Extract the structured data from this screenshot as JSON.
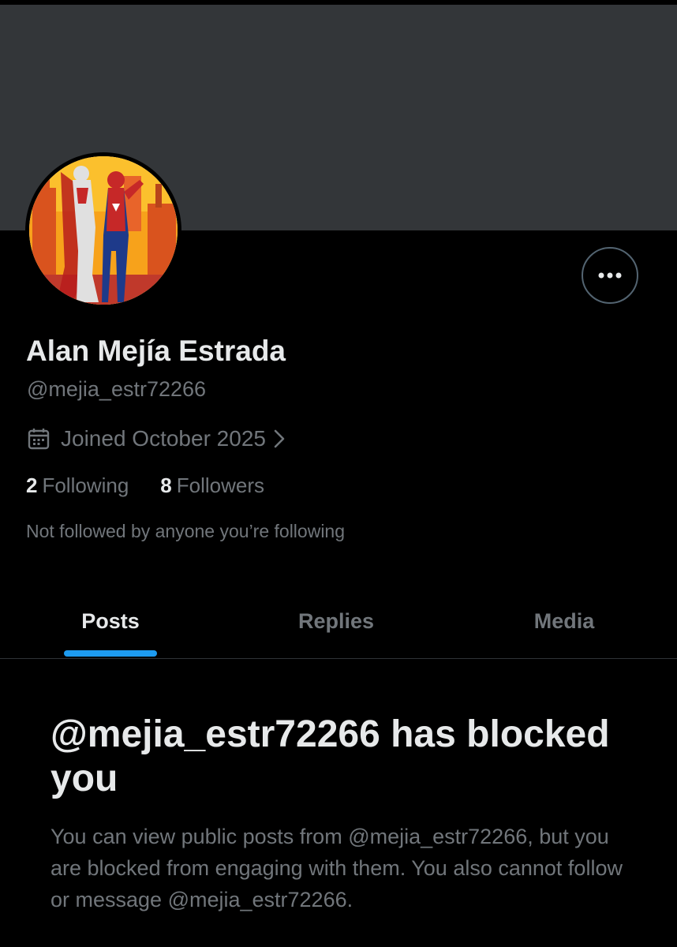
{
  "profile": {
    "display_name": "Alan Mejía Estrada",
    "handle": "@mejia_estr72266",
    "joined": "Joined October 2025",
    "following_count": "2",
    "following_label": "Following",
    "followers_count": "8",
    "followers_label": "Followers",
    "followed_by": "Not followed by anyone you’re following"
  },
  "tabs": [
    {
      "label": "Posts",
      "active": true
    },
    {
      "label": "Replies",
      "active": false
    },
    {
      "label": "Media",
      "active": false
    }
  ],
  "blocked": {
    "title": "@mejia_estr72266 has blocked you",
    "body": "You can view public posts from @mejia_estr72266, but you are blocked from engaging with them. You also cannot follow or message @mejia_estr72266."
  },
  "icons": {
    "more": "more-options-icon",
    "calendar": "calendar-icon",
    "chevron": "chevron-right-icon"
  },
  "colors": {
    "background": "#000000",
    "banner": "#333639",
    "primary_text": "#e7e9ea",
    "secondary_text": "#71767b",
    "accent": "#1d9bf0",
    "divider": "#2f3336"
  }
}
